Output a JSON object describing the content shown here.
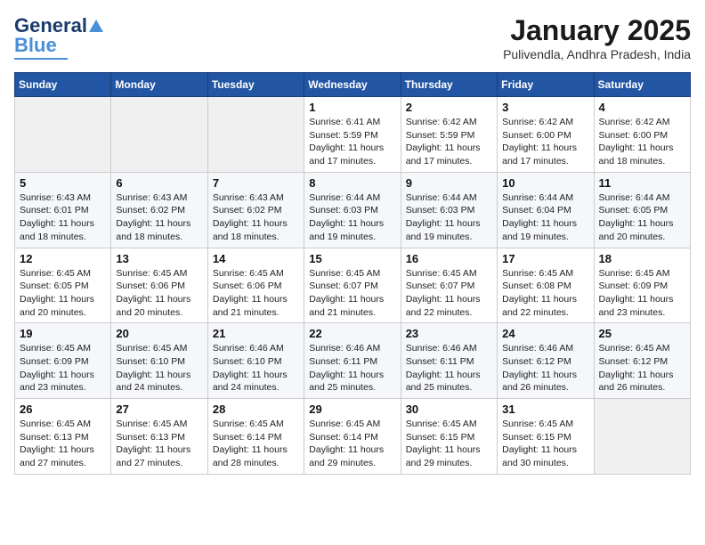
{
  "header": {
    "logo": {
      "general": "General",
      "blue": "Blue"
    },
    "title": "January 2025",
    "subtitle": "Pulivendla, Andhra Pradesh, India"
  },
  "calendar": {
    "days_of_week": [
      "Sunday",
      "Monday",
      "Tuesday",
      "Wednesday",
      "Thursday",
      "Friday",
      "Saturday"
    ],
    "weeks": [
      [
        {
          "day": "",
          "info": ""
        },
        {
          "day": "",
          "info": ""
        },
        {
          "day": "",
          "info": ""
        },
        {
          "day": "1",
          "info": "Sunrise: 6:41 AM\nSunset: 5:59 PM\nDaylight: 11 hours and 17 minutes."
        },
        {
          "day": "2",
          "info": "Sunrise: 6:42 AM\nSunset: 5:59 PM\nDaylight: 11 hours and 17 minutes."
        },
        {
          "day": "3",
          "info": "Sunrise: 6:42 AM\nSunset: 6:00 PM\nDaylight: 11 hours and 17 minutes."
        },
        {
          "day": "4",
          "info": "Sunrise: 6:42 AM\nSunset: 6:00 PM\nDaylight: 11 hours and 18 minutes."
        }
      ],
      [
        {
          "day": "5",
          "info": "Sunrise: 6:43 AM\nSunset: 6:01 PM\nDaylight: 11 hours and 18 minutes."
        },
        {
          "day": "6",
          "info": "Sunrise: 6:43 AM\nSunset: 6:02 PM\nDaylight: 11 hours and 18 minutes."
        },
        {
          "day": "7",
          "info": "Sunrise: 6:43 AM\nSunset: 6:02 PM\nDaylight: 11 hours and 18 minutes."
        },
        {
          "day": "8",
          "info": "Sunrise: 6:44 AM\nSunset: 6:03 PM\nDaylight: 11 hours and 19 minutes."
        },
        {
          "day": "9",
          "info": "Sunrise: 6:44 AM\nSunset: 6:03 PM\nDaylight: 11 hours and 19 minutes."
        },
        {
          "day": "10",
          "info": "Sunrise: 6:44 AM\nSunset: 6:04 PM\nDaylight: 11 hours and 19 minutes."
        },
        {
          "day": "11",
          "info": "Sunrise: 6:44 AM\nSunset: 6:05 PM\nDaylight: 11 hours and 20 minutes."
        }
      ],
      [
        {
          "day": "12",
          "info": "Sunrise: 6:45 AM\nSunset: 6:05 PM\nDaylight: 11 hours and 20 minutes."
        },
        {
          "day": "13",
          "info": "Sunrise: 6:45 AM\nSunset: 6:06 PM\nDaylight: 11 hours and 20 minutes."
        },
        {
          "day": "14",
          "info": "Sunrise: 6:45 AM\nSunset: 6:06 PM\nDaylight: 11 hours and 21 minutes."
        },
        {
          "day": "15",
          "info": "Sunrise: 6:45 AM\nSunset: 6:07 PM\nDaylight: 11 hours and 21 minutes."
        },
        {
          "day": "16",
          "info": "Sunrise: 6:45 AM\nSunset: 6:07 PM\nDaylight: 11 hours and 22 minutes."
        },
        {
          "day": "17",
          "info": "Sunrise: 6:45 AM\nSunset: 6:08 PM\nDaylight: 11 hours and 22 minutes."
        },
        {
          "day": "18",
          "info": "Sunrise: 6:45 AM\nSunset: 6:09 PM\nDaylight: 11 hours and 23 minutes."
        }
      ],
      [
        {
          "day": "19",
          "info": "Sunrise: 6:45 AM\nSunset: 6:09 PM\nDaylight: 11 hours and 23 minutes."
        },
        {
          "day": "20",
          "info": "Sunrise: 6:45 AM\nSunset: 6:10 PM\nDaylight: 11 hours and 24 minutes."
        },
        {
          "day": "21",
          "info": "Sunrise: 6:46 AM\nSunset: 6:10 PM\nDaylight: 11 hours and 24 minutes."
        },
        {
          "day": "22",
          "info": "Sunrise: 6:46 AM\nSunset: 6:11 PM\nDaylight: 11 hours and 25 minutes."
        },
        {
          "day": "23",
          "info": "Sunrise: 6:46 AM\nSunset: 6:11 PM\nDaylight: 11 hours and 25 minutes."
        },
        {
          "day": "24",
          "info": "Sunrise: 6:46 AM\nSunset: 6:12 PM\nDaylight: 11 hours and 26 minutes."
        },
        {
          "day": "25",
          "info": "Sunrise: 6:45 AM\nSunset: 6:12 PM\nDaylight: 11 hours and 26 minutes."
        }
      ],
      [
        {
          "day": "26",
          "info": "Sunrise: 6:45 AM\nSunset: 6:13 PM\nDaylight: 11 hours and 27 minutes."
        },
        {
          "day": "27",
          "info": "Sunrise: 6:45 AM\nSunset: 6:13 PM\nDaylight: 11 hours and 27 minutes."
        },
        {
          "day": "28",
          "info": "Sunrise: 6:45 AM\nSunset: 6:14 PM\nDaylight: 11 hours and 28 minutes."
        },
        {
          "day": "29",
          "info": "Sunrise: 6:45 AM\nSunset: 6:14 PM\nDaylight: 11 hours and 29 minutes."
        },
        {
          "day": "30",
          "info": "Sunrise: 6:45 AM\nSunset: 6:15 PM\nDaylight: 11 hours and 29 minutes."
        },
        {
          "day": "31",
          "info": "Sunrise: 6:45 AM\nSunset: 6:15 PM\nDaylight: 11 hours and 30 minutes."
        },
        {
          "day": "",
          "info": ""
        }
      ]
    ]
  }
}
